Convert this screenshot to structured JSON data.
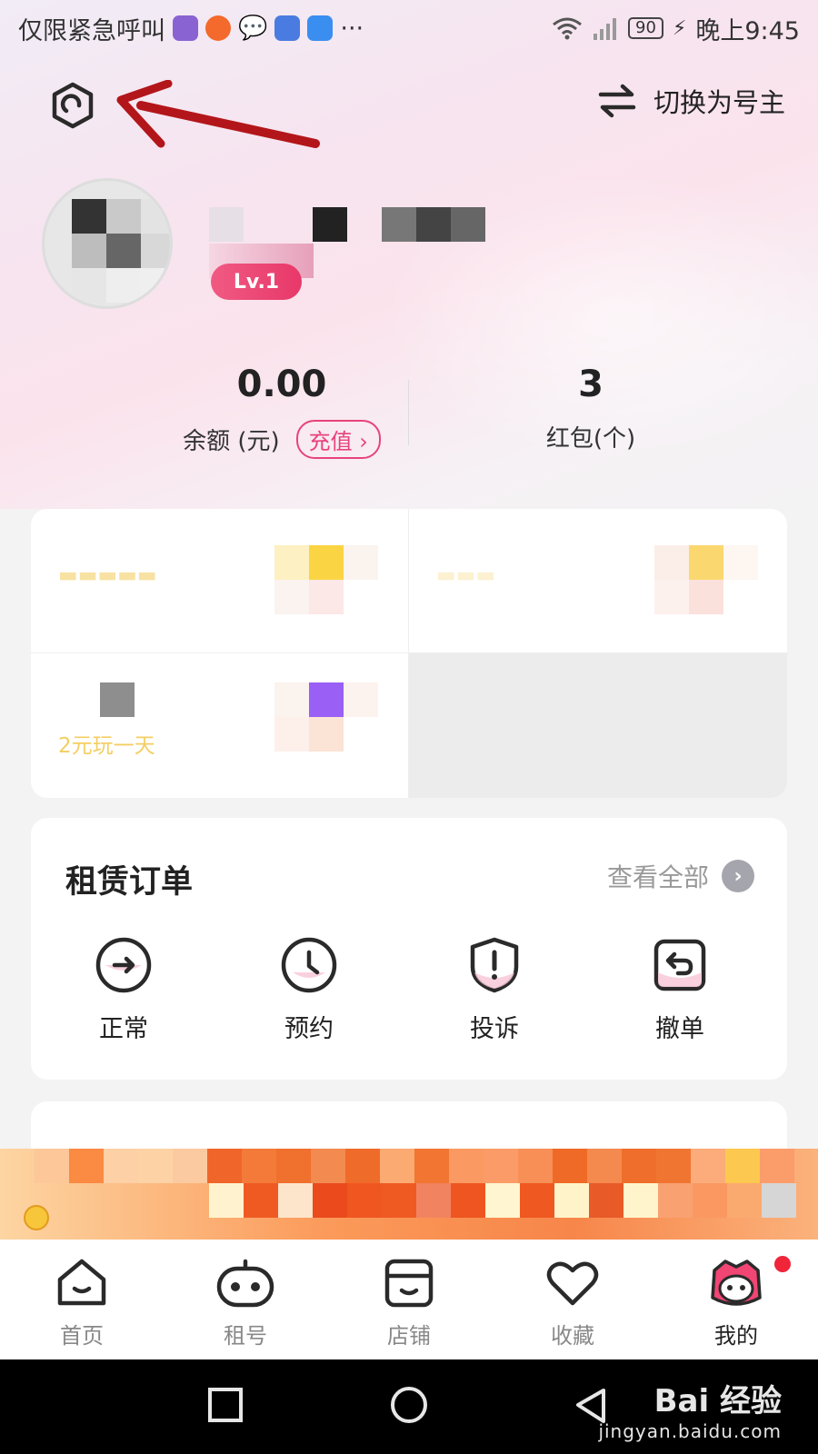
{
  "status_bar": {
    "carrier_text": "仅限紧急呼叫",
    "more_indicator": "···",
    "battery": "90",
    "time": "晚上9:45"
  },
  "top_nav": {
    "settings_icon": "hexagon-settings-icon",
    "switch_label": "切换为号主",
    "switch_icon": "swap-arrows-icon"
  },
  "profile": {
    "level": "Lv.1"
  },
  "stats": {
    "balance_value": "0.00",
    "balance_label": "余额 (元)",
    "recharge_label": "充值 ›",
    "redpack_value": "3",
    "redpack_label": "红包(个)"
  },
  "promo": {
    "cell3_title": "2元玩一天"
  },
  "orders": {
    "title": "租赁订单",
    "view_all": "查看全部",
    "items": [
      {
        "label": "正常",
        "icon": "arrow-circle-icon"
      },
      {
        "label": "预约",
        "icon": "clock-icon"
      },
      {
        "label": "投诉",
        "icon": "shield-alert-icon"
      },
      {
        "label": "撤单",
        "icon": "undo-icon"
      }
    ]
  },
  "tabs": [
    {
      "label": "首页",
      "icon": "home-icon",
      "active": false
    },
    {
      "label": "租号",
      "icon": "gamepad-icon",
      "active": false
    },
    {
      "label": "店铺",
      "icon": "store-icon",
      "active": false
    },
    {
      "label": "收藏",
      "icon": "heart-icon",
      "active": false
    },
    {
      "label": "我的",
      "icon": "avatar-icon",
      "active": true
    }
  ],
  "system_nav": {
    "watermark_main": "Bai 经验",
    "watermark_sub": "jingyan.baidu.com"
  },
  "colors": {
    "accent_pink": "#e8437a",
    "annotation_arrow": "#b3161a",
    "promo_yellow": "#f2c648"
  }
}
